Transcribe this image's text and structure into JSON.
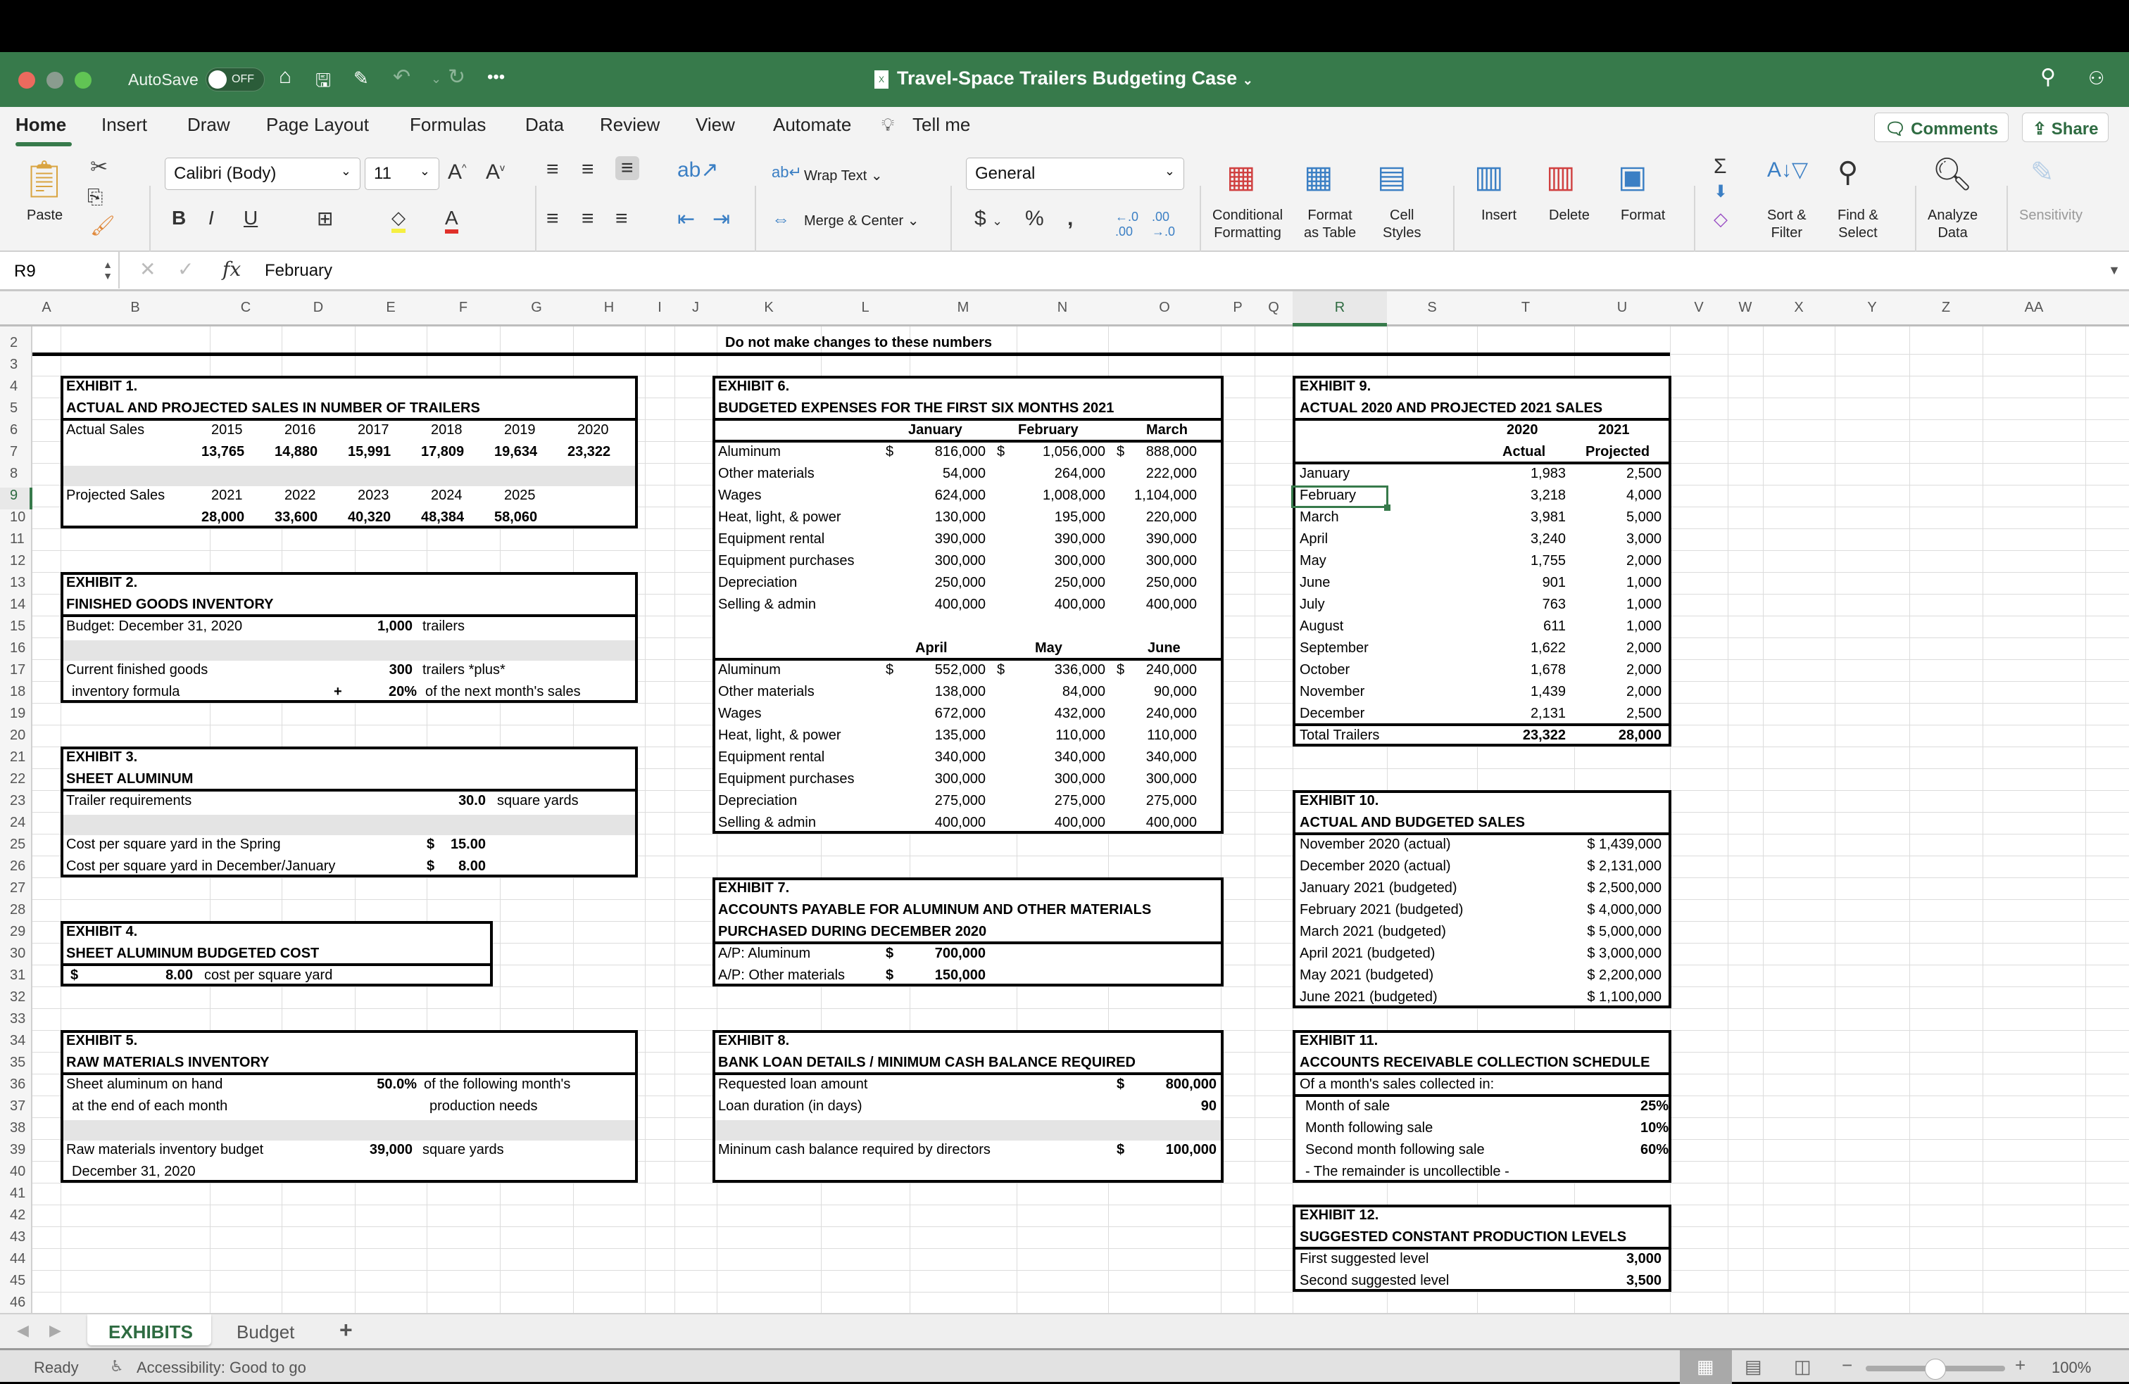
{
  "window": {
    "title": "Travel-Space Trailers Budgeting Case",
    "autosave_label": "AutoSave",
    "autosave_state": "OFF"
  },
  "ribbon": {
    "tabs": [
      "Home",
      "Insert",
      "Draw",
      "Page Layout",
      "Formulas",
      "Data",
      "Review",
      "View",
      "Automate",
      "Tell me"
    ],
    "active_tab": "Home",
    "comments_label": "Comments",
    "share_label": "Share",
    "paste_label": "Paste",
    "font_name": "Calibri (Body)",
    "font_size": "11",
    "wrap_text_label": "Wrap Text",
    "merge_center_label": "Merge & Center",
    "number_format": "General",
    "conditional_formatting_label": "Conditional\nFormatting",
    "format_as_table_label": "Format\nas Table",
    "cell_styles_label": "Cell\nStyles",
    "insert_label": "Insert",
    "delete_label": "Delete",
    "format_label": "Format",
    "sort_filter_label": "Sort &\nFilter",
    "find_select_label": "Find &\nSelect",
    "analyze_data_label": "Analyze\nData",
    "sensitivity_label": "Sensitivity"
  },
  "formula_bar": {
    "name_box": "R9",
    "value": "February"
  },
  "columns": [
    "A",
    "B",
    "C",
    "D",
    "E",
    "F",
    "G",
    "H",
    "I",
    "J",
    "K",
    "L",
    "M",
    "N",
    "O",
    "P",
    "Q",
    "R",
    "S",
    "T",
    "U",
    "V",
    "W",
    "X",
    "Y",
    "Z",
    "AA"
  ],
  "selected_column": "R",
  "selected_row": "9",
  "rows": [
    "2",
    "3",
    "4",
    "5",
    "6",
    "7",
    "8",
    "9",
    "10",
    "11",
    "12",
    "13",
    "14",
    "15",
    "16",
    "17",
    "18",
    "19",
    "20",
    "21",
    "22",
    "23",
    "24",
    "25",
    "26",
    "27",
    "28",
    "29",
    "30",
    "31",
    "32",
    "33",
    "34",
    "35",
    "36",
    "37",
    "38",
    "39",
    "40",
    "41",
    "42",
    "43",
    "44",
    "45",
    "46"
  ],
  "note": "Do not make changes to these numbers",
  "exhibit1": {
    "num": "EXHIBIT 1.",
    "title": "ACTUAL AND PROJECTED SALES IN NUMBER OF TRAILERS",
    "actual_label": "Actual Sales",
    "actual_years": [
      "2015",
      "2016",
      "2017",
      "2018",
      "2019",
      "2020"
    ],
    "actual_values": [
      "13,765",
      "14,880",
      "15,991",
      "17,809",
      "19,634",
      "23,322"
    ],
    "projected_label": "Projected Sales",
    "projected_years": [
      "2021",
      "2022",
      "2023",
      "2024",
      "2025"
    ],
    "projected_values": [
      "28,000",
      "33,600",
      "40,320",
      "48,384",
      "58,060"
    ]
  },
  "exhibit2": {
    "num": "EXHIBIT 2.",
    "title": "FINISHED GOODS INVENTORY",
    "budget_label": "Budget: December 31, 2020",
    "budget_value": "1,000",
    "budget_unit": "trailers",
    "formula_label_1": "Current finished goods",
    "formula_label_2": "inventory formula",
    "plus": "+",
    "formula_value_1": "300",
    "formula_unit_1": "trailers *plus*",
    "formula_value_2": "20%",
    "formula_unit_2": "of the next month's sales"
  },
  "exhibit3": {
    "num": "EXHIBIT 3.",
    "title": "SHEET ALUMINUM",
    "req_label": "Trailer requirements",
    "req_value": "30.0",
    "req_unit": "square yards",
    "spring_label": "Cost per square yard in the Spring",
    "spring_value": "15.00",
    "dec_label": "Cost per square yard in December/January",
    "dec_value": "8.00",
    "currency": "$"
  },
  "exhibit4": {
    "num": "EXHIBIT 4.",
    "title": "SHEET ALUMINUM BUDGETED COST",
    "currency": "$",
    "value": "8.00",
    "unit": "cost per square yard"
  },
  "exhibit5": {
    "num": "EXHIBIT 5.",
    "title": "RAW MATERIALS INVENTORY",
    "label_1": "Sheet aluminum on hand",
    "label_2": "at the end of each month",
    "pct": "50.0%",
    "pct_text_1": "of the following month's",
    "pct_text_2": "production needs",
    "budget_label_1": "Raw materials inventory budget",
    "budget_label_2": "December 31, 2020",
    "budget_value": "39,000",
    "budget_unit": "square yards"
  },
  "exhibit6": {
    "num": "EXHIBIT 6.",
    "title": "BUDGETED EXPENSES FOR THE FIRST SIX MONTHS 2021",
    "items": [
      "Aluminum",
      "Other materials",
      "Wages",
      "Heat, light, & power",
      "Equipment rental",
      "Equipment purchases",
      "Depreciation",
      "Selling & admin"
    ],
    "q1_months": [
      "January",
      "February",
      "March"
    ],
    "q1_values": [
      [
        "816,000",
        "1,056,000",
        "888,000"
      ],
      [
        "54,000",
        "264,000",
        "222,000"
      ],
      [
        "624,000",
        "1,008,000",
        "1,104,000"
      ],
      [
        "130,000",
        "195,000",
        "220,000"
      ],
      [
        "390,000",
        "390,000",
        "390,000"
      ],
      [
        "300,000",
        "300,000",
        "300,000"
      ],
      [
        "250,000",
        "250,000",
        "250,000"
      ],
      [
        "400,000",
        "400,000",
        "400,000"
      ]
    ],
    "q2_months": [
      "April",
      "May",
      "June"
    ],
    "q2_values": [
      [
        "552,000",
        "336,000",
        "240,000"
      ],
      [
        "138,000",
        "84,000",
        "90,000"
      ],
      [
        "672,000",
        "432,000",
        "240,000"
      ],
      [
        "135,000",
        "110,000",
        "110,000"
      ],
      [
        "340,000",
        "340,000",
        "340,000"
      ],
      [
        "300,000",
        "300,000",
        "300,000"
      ],
      [
        "275,000",
        "275,000",
        "275,000"
      ],
      [
        "400,000",
        "400,000",
        "400,000"
      ]
    ],
    "currency": "$"
  },
  "exhibit7": {
    "num": "EXHIBIT 7.",
    "title_1": "ACCOUNTS PAYABLE FOR ALUMINUM AND OTHER MATERIALS",
    "title_2": "PURCHASED DURING DECEMBER 2020",
    "rows": [
      {
        "label": "A/P:  Aluminum",
        "currency": "$",
        "value": "700,000"
      },
      {
        "label": "A/P:  Other materials",
        "currency": "$",
        "value": "150,000"
      }
    ]
  },
  "exhibit8": {
    "num": "EXHIBIT 8.",
    "title": "BANK LOAN DETAILS / MINIMUM CASH BALANCE REQUIRED",
    "loan_label": "Requested loan amount",
    "loan_value": "800,000",
    "duration_label": "Loan duration (in days)",
    "duration_value": "90",
    "min_cash_label": "Mininum cash balance required by directors",
    "min_cash_value": "100,000",
    "currency": "$"
  },
  "exhibit9": {
    "num": "EXHIBIT 9.",
    "title": "ACTUAL 2020 AND PROJECTED 2021 SALES",
    "col1_year": "2020",
    "col1_label": "Actual",
    "col2_year": "2021",
    "col2_label": "Projected",
    "months": [
      "January",
      "February",
      "March",
      "April",
      "May",
      "June",
      "July",
      "August",
      "September",
      "October",
      "November",
      "December"
    ],
    "actual": [
      "1,983",
      "3,218",
      "3,981",
      "3,240",
      "1,755",
      "901",
      "763",
      "611",
      "1,622",
      "1,678",
      "1,439",
      "2,131"
    ],
    "projected": [
      "2,500",
      "4,000",
      "5,000",
      "3,000",
      "2,000",
      "1,000",
      "1,000",
      "1,000",
      "2,000",
      "2,000",
      "2,000",
      "2,500"
    ],
    "total_label": "Total Trailers",
    "total_actual": "23,322",
    "total_projected": "28,000"
  },
  "exhibit10": {
    "num": "EXHIBIT 10.",
    "title": "ACTUAL AND BUDGETED SALES",
    "rows": [
      {
        "label": "November 2020 (actual)",
        "value": "$ 1,439,000"
      },
      {
        "label": "December 2020 (actual)",
        "value": "$ 2,131,000"
      },
      {
        "label": "January 2021 (budgeted)",
        "value": "$ 2,500,000"
      },
      {
        "label": "February 2021 (budgeted)",
        "value": "$ 4,000,000"
      },
      {
        "label": "March 2021 (budgeted)",
        "value": "$ 5,000,000"
      },
      {
        "label": "April 2021 (budgeted)",
        "value": "$ 3,000,000"
      },
      {
        "label": "May 2021 (budgeted)",
        "value": "$ 2,200,000"
      },
      {
        "label": "June 2021 (budgeted)",
        "value": "$ 1,100,000"
      }
    ]
  },
  "exhibit11": {
    "num": "EXHIBIT 11.",
    "title": "ACCOUNTS RECEIVABLE COLLECTION SCHEDULE",
    "intro": "Of a month's sales collected in:",
    "rows": [
      {
        "label": "Month of sale",
        "value": "25%"
      },
      {
        "label": "Month following sale",
        "value": "10%"
      },
      {
        "label": "Second month following sale",
        "value": "60%"
      }
    ],
    "note": "- The remainder is uncollectible -"
  },
  "exhibit12": {
    "num": "EXHIBIT 12.",
    "title": "SUGGESTED CONSTANT PRODUCTION LEVELS",
    "rows": [
      {
        "label": "First suggested level",
        "value": "3,000"
      },
      {
        "label": "Second suggested level",
        "value": "3,500"
      }
    ]
  },
  "sheets": [
    "EXHIBITS",
    "Budget"
  ],
  "active_sheet": "EXHIBITS",
  "status": {
    "ready": "Ready",
    "accessibility": "Accessibility: Good to go",
    "zoom": "100%",
    "zoom_fraction": 0.5
  }
}
